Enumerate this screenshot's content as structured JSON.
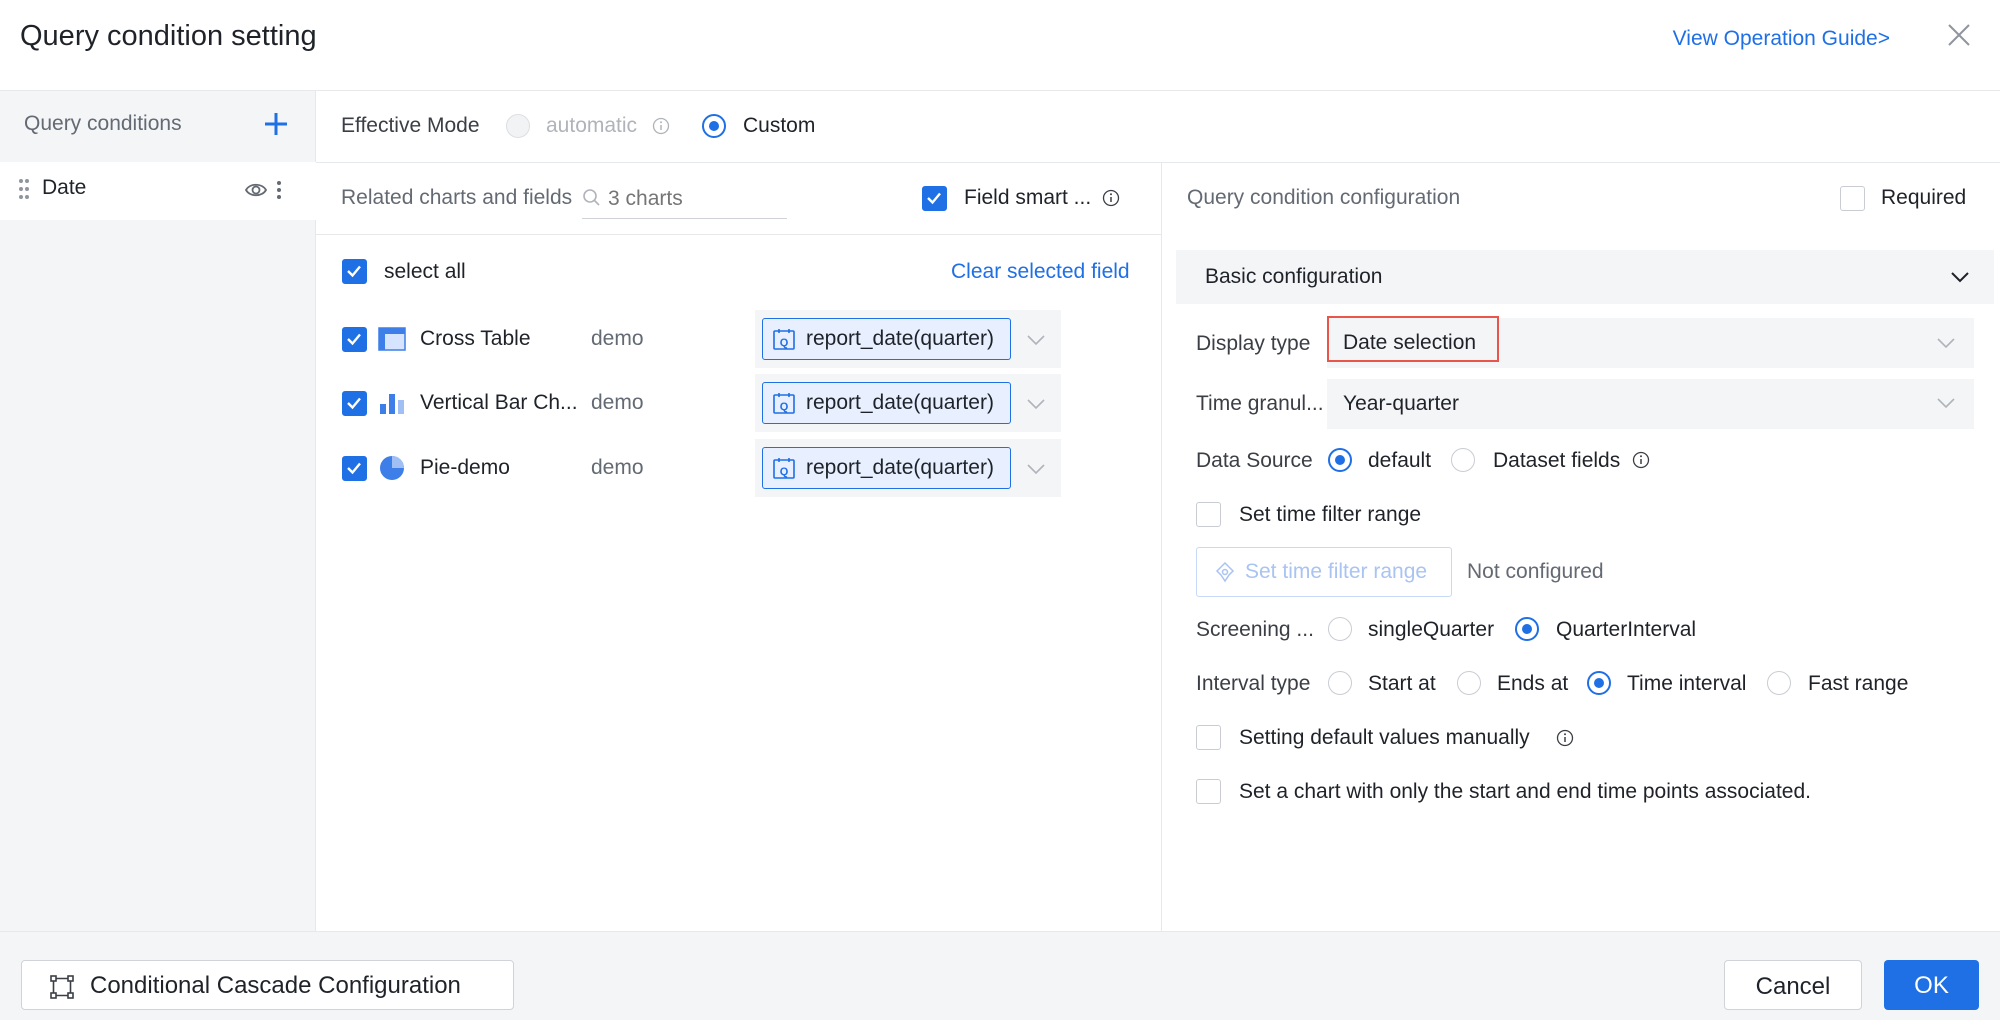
{
  "dialog": {
    "title": "Query condition setting",
    "guide_link": "View Operation Guide>"
  },
  "sidebar": {
    "heading": "Query conditions",
    "items": [
      {
        "label": "Date"
      }
    ]
  },
  "effective_mode": {
    "label": "Effective Mode",
    "options": [
      {
        "label": "automatic",
        "selected": false,
        "disabled": true
      },
      {
        "label": "Custom",
        "selected": true,
        "disabled": false
      }
    ]
  },
  "related": {
    "label": "Related charts and fields",
    "search_placeholder": "3 charts",
    "smart_label": "Field smart ...",
    "smart_checked": true,
    "select_all": "select all",
    "clear_label": "Clear selected field",
    "charts": [
      {
        "name": "Cross Table",
        "dataset": "demo",
        "field": "report_date(quarter)",
        "icon": "cross-table-icon",
        "checked": true
      },
      {
        "name": "Vertical Bar Ch...",
        "dataset": "demo",
        "field": "report_date(quarter)",
        "icon": "bar-chart-icon",
        "checked": true
      },
      {
        "name": "Pie-demo",
        "dataset": "demo",
        "field": "report_date(quarter)",
        "icon": "pie-chart-icon",
        "checked": true
      }
    ]
  },
  "config": {
    "header": "Query condition configuration",
    "required_label": "Required",
    "section_title": "Basic configuration",
    "display_type": {
      "label": "Display type",
      "value": "Date selection"
    },
    "time_granularity": {
      "label": "Time granul...",
      "value": "Year-quarter"
    },
    "data_source": {
      "label": "Data Source",
      "options": [
        {
          "label": "default",
          "selected": true
        },
        {
          "label": "Dataset fields",
          "selected": false
        }
      ]
    },
    "set_time_filter": {
      "label": "Set time filter range",
      "checked": false
    },
    "filter_range_button": "Set time filter range",
    "filter_range_status": "Not configured",
    "screening": {
      "label": "Screening ...",
      "options": [
        {
          "label": "singleQuarter",
          "selected": false
        },
        {
          "label": "QuarterInterval",
          "selected": true
        }
      ]
    },
    "interval_type": {
      "label": "Interval type",
      "options": [
        {
          "label": "Start at",
          "selected": false
        },
        {
          "label": "Ends at",
          "selected": false
        },
        {
          "label": "Time interval",
          "selected": true
        },
        {
          "label": "Fast range",
          "selected": false
        }
      ]
    },
    "default_values": {
      "label": "Setting default values manually",
      "checked": false
    },
    "start_end_assoc": {
      "label": "Set a chart with only the start and end time points associated.",
      "checked": false
    }
  },
  "footer": {
    "cascade_button": "Conditional Cascade Configuration",
    "cancel": "Cancel",
    "ok": "OK"
  },
  "colors": {
    "accent": "#1f6fe5",
    "highlight": "#e8554a",
    "panel_bg": "#f4f5f7"
  }
}
